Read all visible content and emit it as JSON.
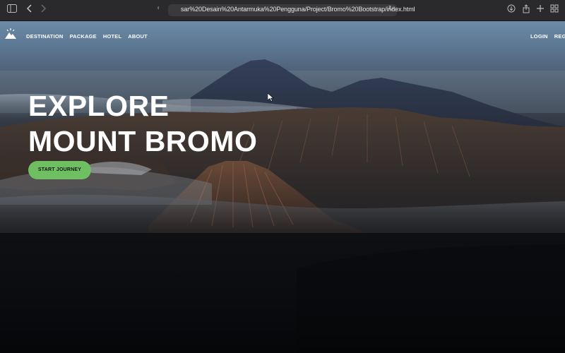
{
  "browser": {
    "url": "sar%20Desain%20Antarmuka%20Pengguna/Project/Bromo%20Bootstrap/index.html",
    "icons": [
      "sidebar-icon",
      "back-icon",
      "forward-icon",
      "shield-icon",
      "reload-icon",
      "download-icon",
      "share-icon",
      "new-tab-icon",
      "tab-overview-icon"
    ]
  },
  "nav": {
    "links": [
      "DESTINATION",
      "PACKAGE",
      "HOTEL",
      "ABOUT"
    ],
    "login": "LOGIN",
    "register": "REGIST"
  },
  "hero": {
    "title_line1": "EXPLORE",
    "title_line2": "MOUNT BROMO",
    "cta_label": "START JOURNEY"
  },
  "colors": {
    "accent": "#6fbf62",
    "chrome": "#2a2a2c"
  }
}
